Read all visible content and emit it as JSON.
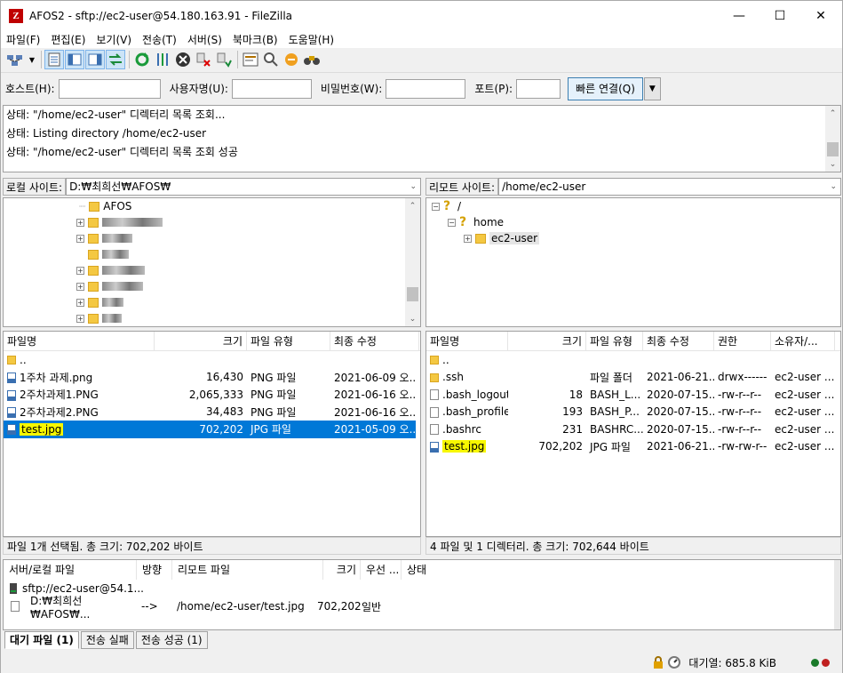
{
  "window": {
    "title": "AFOS2 - sftp://ec2-user@54.180.163.91 - FileZilla",
    "app_icon": "Z",
    "minimize": "—",
    "maximize": "☐",
    "close": "✕"
  },
  "menu": [
    "파일(F)",
    "편집(E)",
    "보기(V)",
    "전송(T)",
    "서버(S)",
    "북마크(B)",
    "도움말(H)"
  ],
  "toolbar_icons": [
    "site-manager-icon",
    "dropdown-icon",
    "toggle-log-icon",
    "toggle-local-tree-icon",
    "toggle-remote-tree-icon",
    "toggle-queue-icon",
    "refresh-icon",
    "process-queue-icon",
    "cancel-icon",
    "disconnect-icon",
    "reconnect-icon",
    "filter-icon",
    "compare-icon",
    "sync-browse-icon",
    "search-icon"
  ],
  "quickconnect": {
    "host_label": "호스트(H):",
    "host_value": "",
    "user_label": "사용자명(U):",
    "user_value": "",
    "pass_label": "비밀번호(W):",
    "pass_value": "",
    "port_label": "포트(P):",
    "port_value": "",
    "connect_label": "빠른 연결(Q)"
  },
  "log": [
    "상태: \"/home/ec2-user\" 디렉터리 목록 조회...",
    "상태: Listing directory /home/ec2-user",
    "상태: \"/home/ec2-user\" 디렉터리 목록 조회 성공"
  ],
  "local": {
    "site_label": "로컬 사이트:",
    "path": "D:₩최희선₩AFOS₩",
    "tree_first": "AFOS",
    "headers": [
      "파일명",
      "크기",
      "파일 유형",
      "최종 수정"
    ],
    "rows": [
      {
        "name": "..",
        "size": "",
        "type": "",
        "modified": "",
        "icon": "folder"
      },
      {
        "name": "1주차 과제.png",
        "size": "16,430",
        "type": "PNG 파일",
        "modified": "2021-06-09 오...",
        "icon": "image"
      },
      {
        "name": "2주차과제1.PNG",
        "size": "2,065,333",
        "type": "PNG 파일",
        "modified": "2021-06-16 오...",
        "icon": "image"
      },
      {
        "name": "2주차과제2.PNG",
        "size": "34,483",
        "type": "PNG 파일",
        "modified": "2021-06-16 오...",
        "icon": "image"
      },
      {
        "name": "test.jpg",
        "size": "702,202",
        "type": "JPG 파일",
        "modified": "2021-05-09 오...",
        "icon": "image"
      }
    ],
    "status": "파일 1개 선택됨. 총 크기: 702,202 바이트"
  },
  "remote": {
    "site_label": "리모트 사이트:",
    "path": "/home/ec2-user",
    "tree": [
      "/",
      "home",
      "ec2-user"
    ],
    "headers": [
      "파일명",
      "크기",
      "파일 유형",
      "최종 수정",
      "권한",
      "소유자/..."
    ],
    "rows": [
      {
        "name": "..",
        "size": "",
        "type": "",
        "modified": "",
        "perm": "",
        "owner": "",
        "icon": "folder"
      },
      {
        "name": ".ssh",
        "size": "",
        "type": "파일 폴더",
        "modified": "2021-06-21...",
        "perm": "drwx------",
        "owner": "ec2-user ...",
        "icon": "folder"
      },
      {
        "name": ".bash_logout",
        "size": "18",
        "type": "BASH_L...",
        "modified": "2020-07-15...",
        "perm": "-rw-r--r--",
        "owner": "ec2-user ...",
        "icon": "file"
      },
      {
        "name": ".bash_profile",
        "size": "193",
        "type": "BASH_P...",
        "modified": "2020-07-15...",
        "perm": "-rw-r--r--",
        "owner": "ec2-user ...",
        "icon": "file"
      },
      {
        "name": ".bashrc",
        "size": "231",
        "type": "BASHRC...",
        "modified": "2020-07-15...",
        "perm": "-rw-r--r--",
        "owner": "ec2-user ...",
        "icon": "file"
      },
      {
        "name": "test.jpg",
        "size": "702,202",
        "type": "JPG 파일",
        "modified": "2021-06-21...",
        "perm": "-rw-rw-r--",
        "owner": "ec2-user ...",
        "icon": "image"
      }
    ],
    "status": "4 파일 및 1 디렉터리. 총 크기: 702,644 바이트"
  },
  "queue": {
    "headers": [
      "서버/로컬 파일",
      "방향",
      "리모트 파일",
      "크기",
      "우선 ...",
      "상태"
    ],
    "server": "sftp://ec2-user@54.1...",
    "row": {
      "local": "D:₩최희선₩AFOS₩...",
      "dir": "-->",
      "remote": "/home/ec2-user/test.jpg",
      "size": "702,202",
      "priority": "일반",
      "status": ""
    }
  },
  "tabs": [
    "대기 파일 (1)",
    "전송 실패",
    "전송 성공 (1)"
  ],
  "statusbar": {
    "queue_label": "대기열: 685.8 KiB"
  }
}
